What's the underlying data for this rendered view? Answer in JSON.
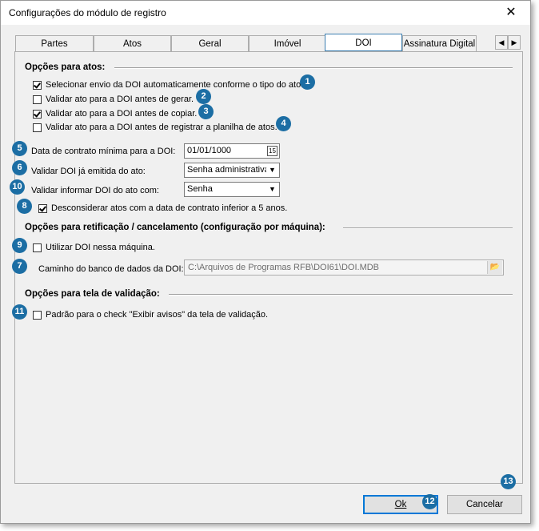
{
  "window": {
    "title": "Configurações do módulo de registro",
    "close_glyph": "✕"
  },
  "tabs": [
    {
      "label": "Partes"
    },
    {
      "label": "Atos"
    },
    {
      "label": "Geral"
    },
    {
      "label": "Imóvel"
    },
    {
      "label": "DOI"
    },
    {
      "label": "Assinatura Digital"
    }
  ],
  "tab_scroll": {
    "left": "◀",
    "right": "▶"
  },
  "sections": {
    "atos": "Opções para atos:",
    "retificacao": "Opções para retificação / cancelamento (configuração por máquina):",
    "validacao": "Opções para tela de validação:"
  },
  "options": {
    "selecionar_envio": {
      "label": "Selecionar envio da DOI automaticamente conforme o tipo do ato.",
      "checked": true
    },
    "validar_gerar": {
      "label": "Validar ato para a DOI antes de gerar.",
      "checked": false
    },
    "validar_copiar": {
      "label": "Validar ato para a DOI antes de copiar.",
      "checked": true
    },
    "validar_registrar": {
      "label": "Validar ato para a DOI antes de registrar a planilha de atos.",
      "checked": false
    },
    "data_contrato": {
      "label": "Data de contrato mínima para a DOI:",
      "value": "01/01/1000",
      "cal_glyph": "15"
    },
    "validar_emitida": {
      "label": "Validar DOI já emitida do ato:",
      "value": "Senha administrativa"
    },
    "validar_informar": {
      "label": "Validar informar DOI do ato com:",
      "value": "Senha"
    },
    "desconsiderar": {
      "label": "Desconsiderar atos com a data de contrato inferior a 5 anos.",
      "checked": true
    },
    "utilizar_doi": {
      "label": "Utilizar DOI nessa máquina.",
      "checked": false
    },
    "caminho": {
      "label": "Caminho do banco de dados da DOI:",
      "value": "C:\\Arquivos de Programas RFB\\DOI61\\DOI.MDB"
    },
    "padrao_check": {
      "label": "Padrão para o check \"Exibir avisos\" da tela de validação.",
      "checked": false
    }
  },
  "buttons": {
    "ok": "Ok",
    "cancel": "Cancelar"
  },
  "badges": [
    "1",
    "2",
    "3",
    "4",
    "5",
    "6",
    "10",
    "8",
    "9",
    "7",
    "11",
    "12",
    "13"
  ],
  "accent_color": "#1c6ea4"
}
